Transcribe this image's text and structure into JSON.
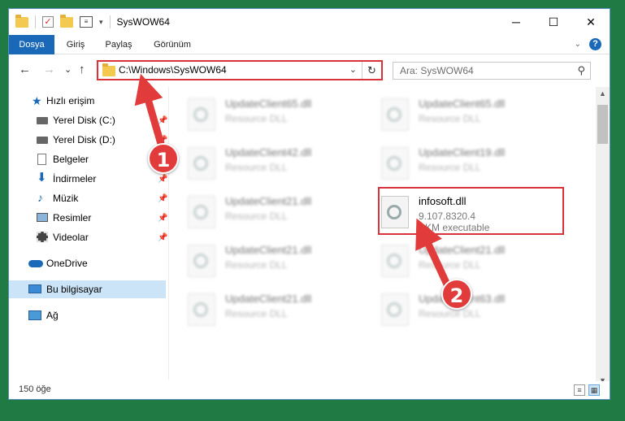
{
  "window": {
    "title": "SysWOW64",
    "controls": {
      "minimize": "─",
      "maximize": "☐",
      "close": "✕"
    }
  },
  "ribbon": {
    "tabs": [
      {
        "label": "Dosya",
        "active": true
      },
      {
        "label": "Giriş",
        "active": false
      },
      {
        "label": "Paylaş",
        "active": false
      },
      {
        "label": "Görünüm",
        "active": false
      }
    ],
    "help": "?"
  },
  "nav": {
    "back": "←",
    "forward": "→",
    "recent": "⌄",
    "up": "↑",
    "address": "C:\\Windows\\SysWOW64",
    "search_placeholder": "Ara: SysWOW64"
  },
  "sidebar": {
    "items": [
      {
        "label": "Hızlı erişim",
        "icon": "star-icon"
      },
      {
        "label": "Yerel Disk (C:)",
        "icon": "drive-icon"
      },
      {
        "label": "Yerel Disk (D:)",
        "icon": "drive-icon"
      },
      {
        "label": "Belgeler",
        "icon": "documents-icon"
      },
      {
        "label": "İndirmeler",
        "icon": "download-icon"
      },
      {
        "label": "Müzik",
        "icon": "music-icon"
      },
      {
        "label": "Resimler",
        "icon": "pictures-icon"
      },
      {
        "label": "Videolar",
        "icon": "video-icon"
      },
      {
        "label": "OneDrive",
        "icon": "cloud-icon"
      },
      {
        "label": "Bu bilgisayar",
        "icon": "computer-icon"
      },
      {
        "label": "Ağ",
        "icon": "network-icon"
      }
    ]
  },
  "files": {
    "left": [
      {
        "name": "UpdateClient65.dll",
        "type": "Resource DLL"
      },
      {
        "name": "UpdateClient42.dll",
        "type": "Resource DLL"
      },
      {
        "name": "UpdateClient21.dll",
        "type": "Resource DLL"
      },
      {
        "name": "UpdateClient21.dll",
        "type": "Resource DLL"
      },
      {
        "name": "UpdateClient21.dll",
        "type": "Resource DLL"
      }
    ],
    "right": [
      {
        "name": "UpdateClient65.dll",
        "type": "Resource DLL"
      },
      {
        "name": "UpdateClient19.dll",
        "type": "Resource DLL"
      },
      {
        "name": "UpdateClient21.dll",
        "type": "Resource DLL"
      },
      {
        "name": "UpdateClient63.dll",
        "type": "Resource DLL"
      }
    ],
    "highlighted": {
      "name": "infosoft.dll",
      "version": "9.107.8320.4",
      "type": "PKM executable"
    }
  },
  "status": {
    "count": "150 öğe"
  },
  "annotations": {
    "step1": "1",
    "step2": "2",
    "color": "#e23b3b"
  }
}
